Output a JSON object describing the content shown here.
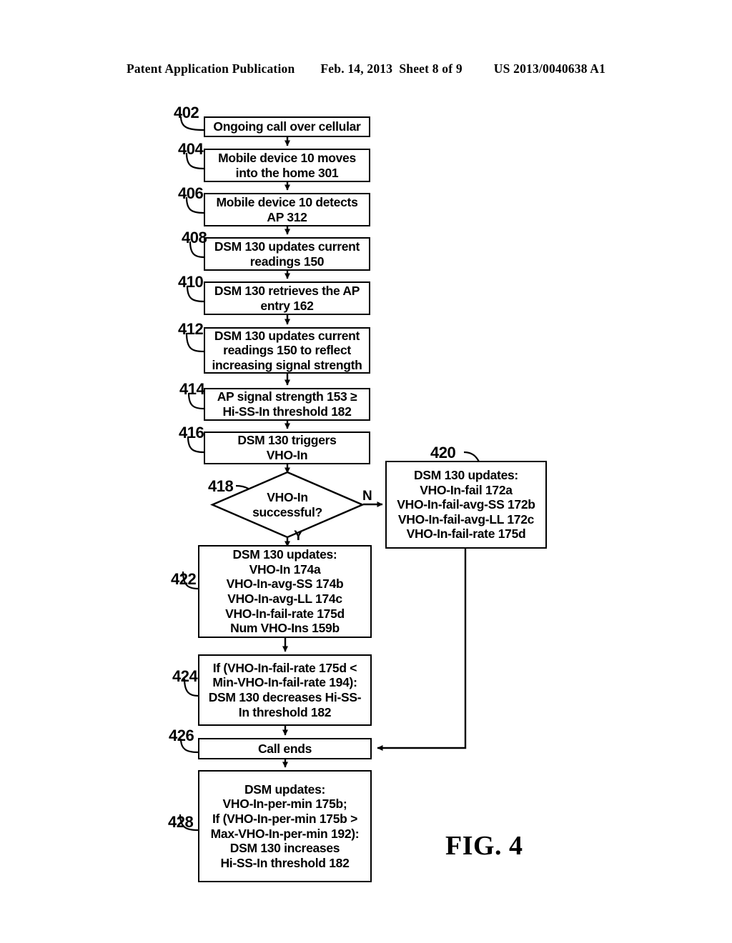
{
  "header": {
    "left": "Patent Application Publication",
    "middle": "Feb. 14, 2013  Sheet 8 of 9",
    "right": "US 2013/0040638 A1"
  },
  "figure": {
    "caption": "FIG. 4"
  },
  "flowchart": {
    "nodes": [
      {
        "ref": "402",
        "shape": "process",
        "text": "Ongoing call over cellular"
      },
      {
        "ref": "404",
        "shape": "process",
        "text": "Mobile device 10 moves\ninto the home 301"
      },
      {
        "ref": "406",
        "shape": "process",
        "text": "Mobile device 10 detects\nAP 312"
      },
      {
        "ref": "408",
        "shape": "process",
        "text": "DSM 130 updates current\nreadings 150"
      },
      {
        "ref": "410",
        "shape": "process",
        "text": "DSM 130 retrieves the AP\nentry 162"
      },
      {
        "ref": "412",
        "shape": "process",
        "text": "DSM 130 updates current\nreadings 150 to reflect\nincreasing signal strength"
      },
      {
        "ref": "414",
        "shape": "process",
        "text": "AP signal strength 153 ≥\nHi-SS-In threshold 182"
      },
      {
        "ref": "416",
        "shape": "process",
        "text": "DSM 130 triggers\nVHO-In"
      },
      {
        "ref": "418",
        "shape": "decision",
        "text": "VHO-In\nsuccessful?"
      },
      {
        "ref": "420",
        "shape": "process",
        "text": "DSM 130 updates:\nVHO-In-fail 172a\nVHO-In-fail-avg-SS 172b\nVHO-In-fail-avg-LL 172c\nVHO-In-fail-rate 175d"
      },
      {
        "ref": "422",
        "shape": "process",
        "text": "DSM 130 updates:\nVHO-In 174a\nVHO-In-avg-SS 174b\nVHO-In-avg-LL 174c\nVHO-In-fail-rate 175d\nNum VHO-Ins 159b"
      },
      {
        "ref": "424",
        "shape": "process",
        "text": "If (VHO-In-fail-rate 175d <\nMin-VHO-In-fail-rate 194):\nDSM 130 decreases Hi-SS-\nIn threshold 182"
      },
      {
        "ref": "426",
        "shape": "process",
        "text": "Call ends"
      },
      {
        "ref": "428",
        "shape": "process",
        "text": "DSM updates:\nVHO-In-per-min 175b;\nIf (VHO-In-per-min 175b >\nMax-VHO-In-per-min 192):\nDSM 130 increases\nHi-SS-In threshold 182"
      }
    ],
    "branch_labels": {
      "no": "N",
      "yes": "Y"
    }
  }
}
